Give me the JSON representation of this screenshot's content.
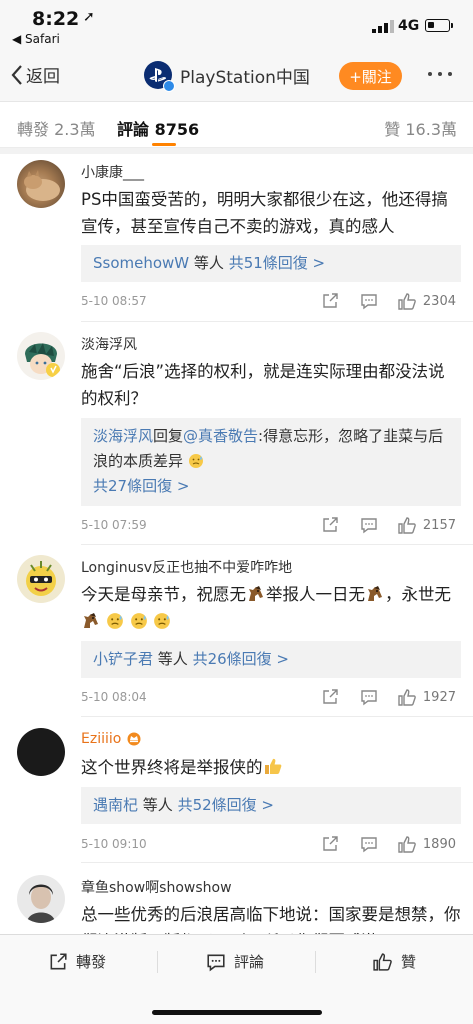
{
  "status_bar": {
    "time": "8:22",
    "back_app": "◀ Safari",
    "network": "4G"
  },
  "nav": {
    "back_label": "返回",
    "title": "PlayStation中国",
    "follow_label": "+關注"
  },
  "tabs": {
    "repost": "轉發 2.3萬",
    "comment": "評論 8756",
    "like": "贊 16.3萬"
  },
  "comments": [
    {
      "user": "小康康___",
      "text": "PS中国蛮受苦的，明明大家都很少在这，他还得搞宣传，甚至宣传自己不卖的游戏，真的感人",
      "replies_who": "SsomehowW",
      "replies_mid": " 等人 ",
      "replies_count": "共51條回復 >",
      "date": "5-10 08:57",
      "likes": "2304"
    },
    {
      "user": "淡海浮风",
      "text": "施舍“后浪”选择的权利，就是连实际理由都没法说的权利？",
      "reply_user": "淡海浮风",
      "reply_verb": "回复",
      "reply_target": "@真香敬告",
      "reply_text": ":得意忘形，忽略了韭菜与后浪的本质差异",
      "replies_count": "共27條回復 >",
      "date": "5-10 07:59",
      "likes": "2157"
    },
    {
      "user": "Longinusv反正也抽不中爱咋咋地",
      "text_a": "今天是母亲节，祝愿无",
      "text_b": "举报人一日无",
      "text_c": "，永世无",
      "replies_who": "小铲子君",
      "replies_mid": " 等人 ",
      "replies_count": "共26條回復 >",
      "date": "5-10 08:04",
      "likes": "1927"
    },
    {
      "user": "Eziiiio",
      "text": "这个世界终将是举报侠的",
      "replies_who": "遇南杞",
      "replies_mid": " 等人 ",
      "replies_count": "共52條回復 >",
      "date": "5-10 09:10",
      "likes": "1890"
    },
    {
      "user": "章鱼show啊showshow",
      "text": "总一些优秀的后浪居高临下地说：国家要是想禁，你们连港版日版都买不到，所以你们要感激"
    }
  ],
  "bottom_bar": {
    "repost": "轉發",
    "comment": "評論",
    "like": "贊"
  },
  "colors": {
    "accent": "#ff8200",
    "link": "#4a7ab3",
    "follow": "#ff8a21"
  }
}
